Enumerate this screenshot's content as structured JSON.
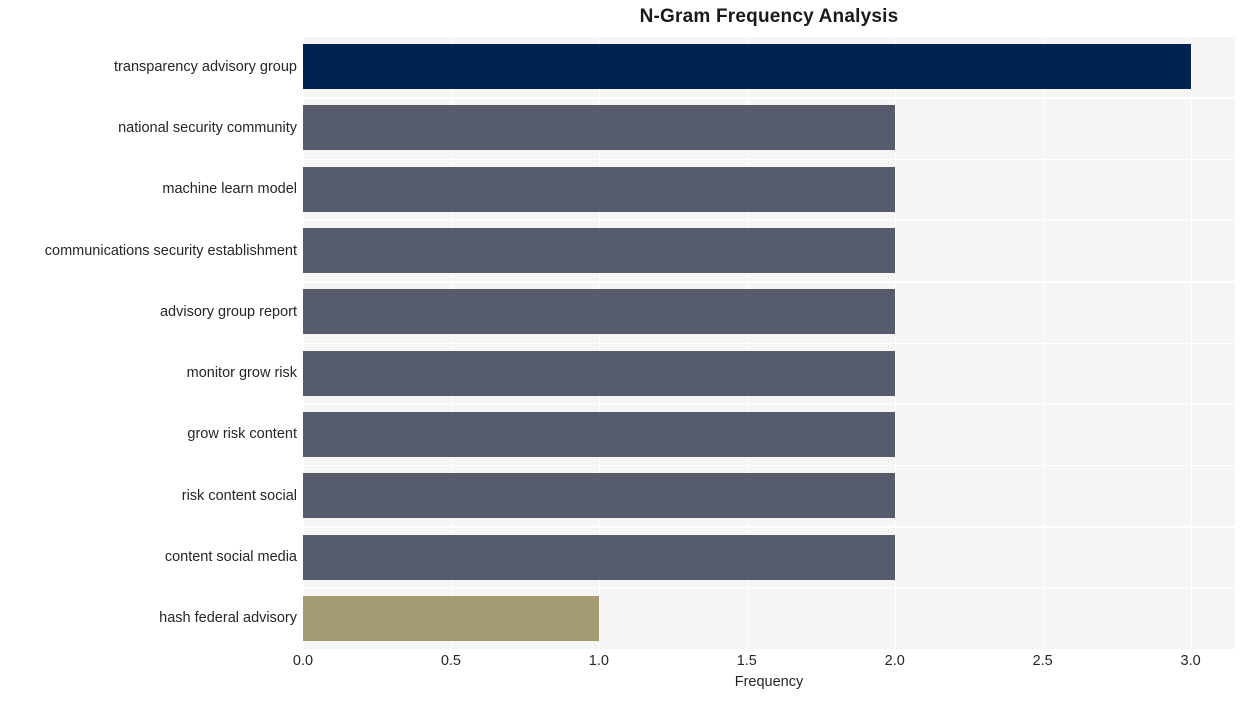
{
  "chart_data": {
    "type": "bar",
    "orientation": "horizontal",
    "title": "N-Gram Frequency Analysis",
    "xlabel": "Frequency",
    "ylabel": "",
    "xlim": [
      0.0,
      3.15
    ],
    "ylim": [
      0,
      10
    ],
    "grid": true,
    "legend": null,
    "xticks": [
      "0.0",
      "0.5",
      "1.0",
      "1.5",
      "2.0",
      "2.5",
      "3.0"
    ],
    "xtick_values": [
      0.0,
      0.5,
      1.0,
      1.5,
      2.0,
      2.5,
      3.0
    ],
    "categories": [
      "transparency advisory group",
      "national security community",
      "machine learn model",
      "communications security establishment",
      "advisory group report",
      "monitor grow risk",
      "grow risk content",
      "risk content social",
      "content social media",
      "hash federal advisory"
    ],
    "values": [
      3,
      2,
      2,
      2,
      2,
      2,
      2,
      2,
      2,
      1
    ],
    "bar_colors": [
      "#00244f",
      "#575c6c",
      "#575c6c",
      "#575c6c",
      "#575c6c",
      "#575c6c",
      "#575c6c",
      "#575c6c",
      "#575c6c",
      "#a59b72"
    ]
  },
  "style": {
    "figure_background": "#ffffff",
    "plot_background": "#f5f5f6",
    "gridline_color": "#ffffff",
    "text_color": "#262626",
    "title_color": "#1a1a1a"
  }
}
